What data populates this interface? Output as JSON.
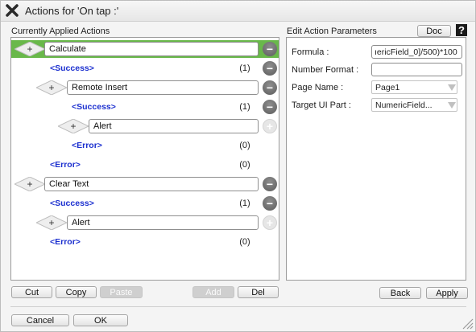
{
  "window": {
    "title": "Actions for 'On tap :'"
  },
  "left_panel": {
    "heading": "Currently Applied Actions"
  },
  "right_panel": {
    "heading": "Edit Action Parameters",
    "doc_label": "Doc",
    "help_label": "?"
  },
  "tree": {
    "actions": [
      {
        "label": "Calculate",
        "expander": "+",
        "button": "−"
      },
      {
        "status": "<Success>",
        "count": "(1)",
        "button": "−"
      },
      {
        "label": "Remote Insert",
        "expander": "+",
        "button": "−"
      },
      {
        "status": "<Success>",
        "count": "(1)",
        "button": "−"
      },
      {
        "label": "Alert",
        "expander": "+",
        "button": "+"
      },
      {
        "status": "<Error>",
        "count": "(0)"
      },
      {
        "status": "<Error>",
        "count": "(0)"
      },
      {
        "label": "Clear Text",
        "expander": "+",
        "button": "−"
      },
      {
        "status": "<Success>",
        "count": "(1)",
        "button": "−"
      },
      {
        "label": "Alert",
        "expander": "+",
        "button": "+"
      },
      {
        "status": "<Error>",
        "count": "(0)"
      }
    ]
  },
  "params": {
    "formula": {
      "label": "Formula :",
      "value": "ıericField_0]/500)*100"
    },
    "number_format": {
      "label": "Number Format :",
      "value": ""
    },
    "page_name": {
      "label": "Page Name :",
      "value": "Page1"
    },
    "target_ui_part": {
      "label": "Target UI Part :",
      "value": "NumericField..."
    }
  },
  "buttons": {
    "cut": "Cut",
    "copy": "Copy",
    "paste": "Paste",
    "add": "Add",
    "del": "Del",
    "back": "Back",
    "apply": "Apply",
    "cancel": "Cancel",
    "ok": "OK"
  },
  "colors": {
    "selected_row": "#69b84a",
    "status_link": "#1b2fcf"
  }
}
